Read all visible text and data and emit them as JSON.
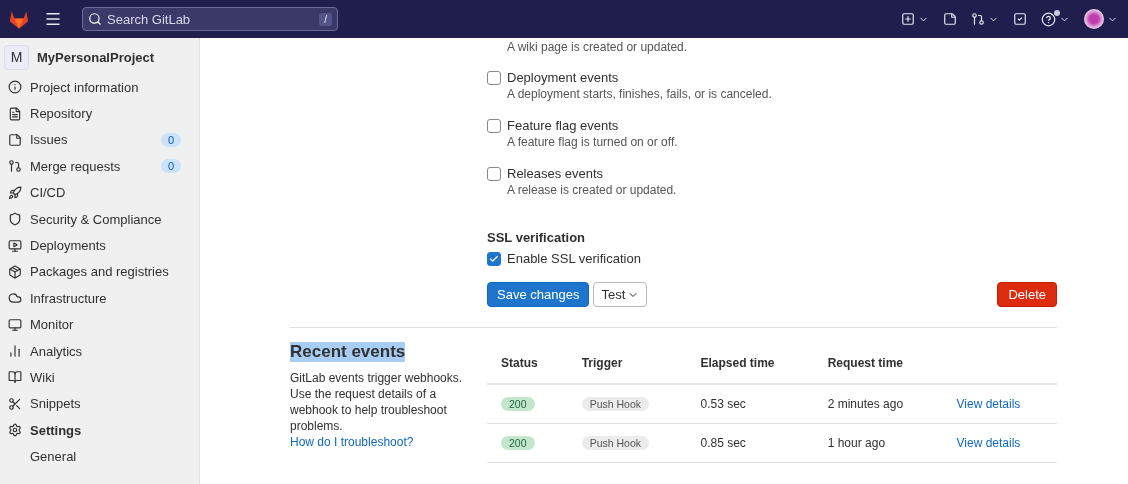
{
  "topbar": {
    "search": {
      "placeholder": "Search GitLab",
      "shortcut": "/"
    },
    "help_badge": true
  },
  "sidebar": {
    "project": {
      "initial": "M",
      "name": "MyPersonalProject"
    },
    "items": [
      {
        "label": "Project information",
        "selected": false
      },
      {
        "label": "Repository",
        "selected": false
      },
      {
        "label": "Issues",
        "count": "0",
        "selected": false
      },
      {
        "label": "Merge requests",
        "count": "0",
        "selected": false
      },
      {
        "label": "CI/CD",
        "selected": false
      },
      {
        "label": "Security & Compliance",
        "selected": false
      },
      {
        "label": "Deployments",
        "selected": false
      },
      {
        "label": "Packages and registries",
        "selected": false
      },
      {
        "label": "Infrastructure",
        "selected": false
      },
      {
        "label": "Monitor",
        "selected": false
      },
      {
        "label": "Analytics",
        "selected": false
      },
      {
        "label": "Wiki",
        "selected": false
      },
      {
        "label": "Snippets",
        "selected": false
      },
      {
        "label": "Settings",
        "selected": true,
        "children": [
          {
            "label": "General",
            "selected": false
          }
        ]
      }
    ]
  },
  "trigger_previous_description": "A wiki page is created or updated.",
  "events": [
    {
      "label": "Deployment events",
      "description": "A deployment starts, finishes, fails, or is canceled.",
      "checked": false
    },
    {
      "label": "Feature flag events",
      "description": "A feature flag is turned on or off.",
      "checked": false
    },
    {
      "label": "Releases events",
      "description": "A release is created or updated.",
      "checked": false
    }
  ],
  "ssl": {
    "heading": "SSL verification",
    "label": "Enable SSL verification",
    "checked": true
  },
  "buttons": {
    "save": "Save changes",
    "test": "Test",
    "delete": "Delete"
  },
  "recent_events": {
    "title": "Recent events",
    "description": "GitLab events trigger webhooks. Use the request details of a webhook to help troubleshoot problems.",
    "link": "How do I troubleshoot?",
    "columns": [
      "Status",
      "Trigger",
      "Elapsed time",
      "Request time"
    ],
    "rows": [
      {
        "status": "200",
        "trigger": "Push Hook",
        "elapsed": "0.53 sec",
        "request": "2 minutes ago",
        "action": "View details"
      },
      {
        "status": "200",
        "trigger": "Push Hook",
        "elapsed": "0.85 sec",
        "request": "1 hour ago",
        "action": "View details"
      }
    ]
  }
}
